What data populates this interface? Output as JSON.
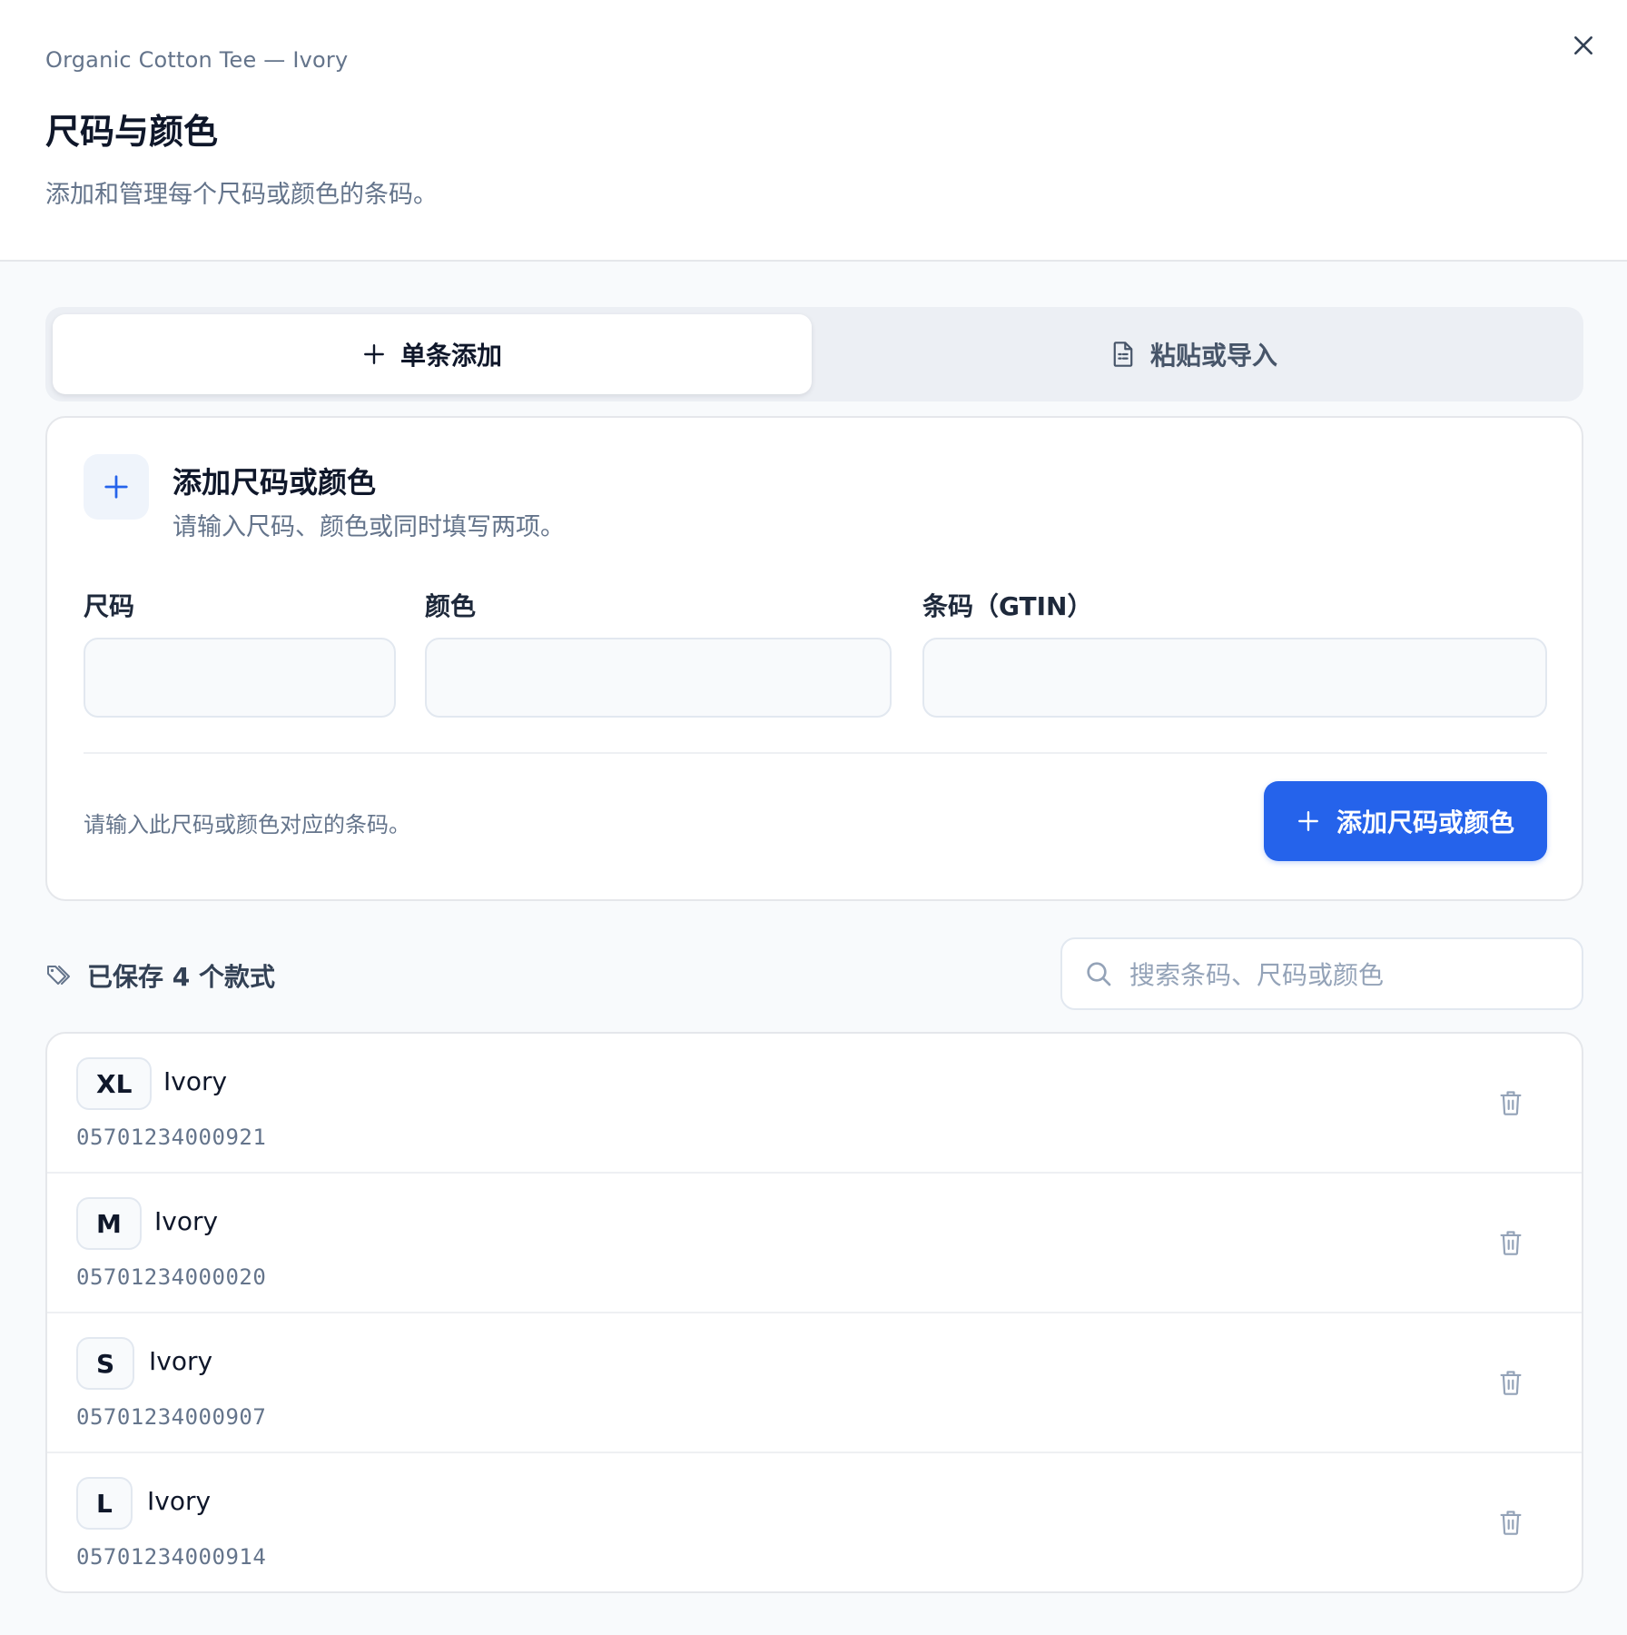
{
  "header": {
    "product_name": "Organic Cotton Tee — Ivory",
    "title": "尺码与颜色",
    "description": "添加和管理每个尺码或颜色的条码。"
  },
  "tabs": [
    {
      "label": "单条添加",
      "icon": "plus-icon",
      "active": true
    },
    {
      "label": "粘贴或导入",
      "icon": "document-icon",
      "active": false
    }
  ],
  "add_card": {
    "title": "添加尺码或颜色",
    "subtitle": "请输入尺码、颜色或同时填写两项。",
    "fields": {
      "size_label": "尺码",
      "color_label": "颜色",
      "gtin_label": "条码（GTIN）",
      "size_value": "",
      "color_value": "",
      "gtin_value": ""
    },
    "hint": "请输入此尺码或颜色对应的条码。",
    "submit_label": "添加尺码或颜色"
  },
  "saved": {
    "heading": "已保存 4 个款式",
    "search_placeholder": "搜索条码、尺码或颜色",
    "items": [
      {
        "size": "XL",
        "color": "Ivory",
        "gtin": "05701234000921"
      },
      {
        "size": "M",
        "color": "Ivory",
        "gtin": "05701234000020"
      },
      {
        "size": "S",
        "color": "Ivory",
        "gtin": "05701234000907"
      },
      {
        "size": "L",
        "color": "Ivory",
        "gtin": "05701234000914"
      }
    ]
  },
  "colors": {
    "accent": "#2563eb",
    "text_primary": "#0f172a",
    "text_muted": "#64748b",
    "border": "#e5e7eb"
  }
}
